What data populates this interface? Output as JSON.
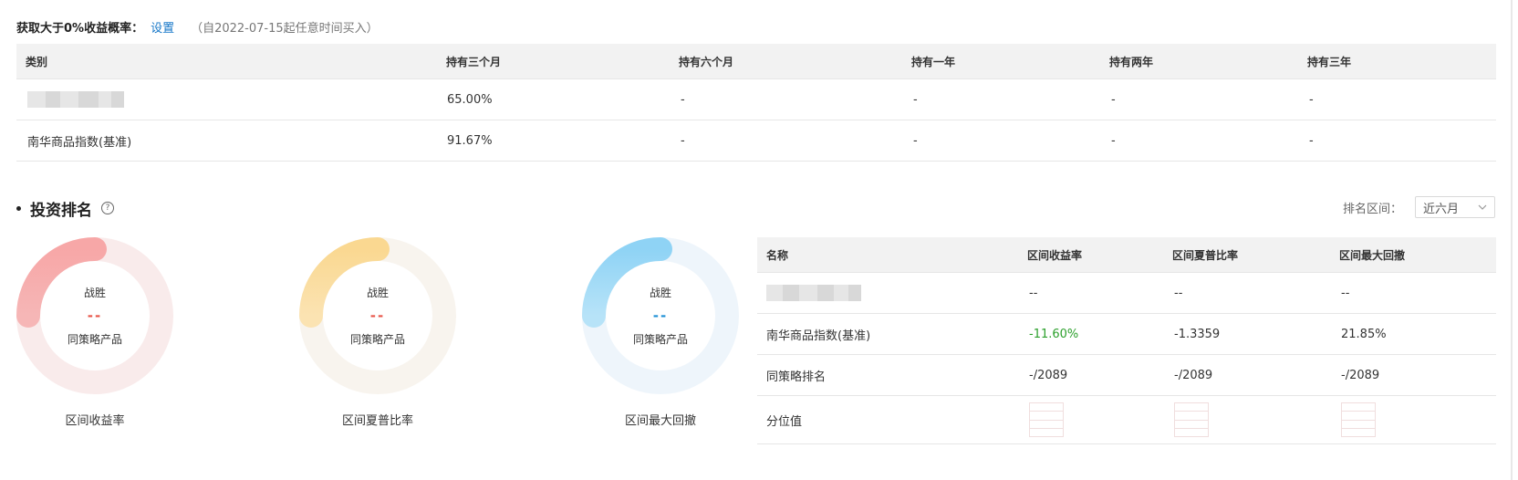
{
  "probability": {
    "label": "获取大于0%收益概率：",
    "link": "设置",
    "note": "（自2022-07-15起任意时间买入）"
  },
  "holding_table": {
    "headers": [
      "类别",
      "持有三个月",
      "持有六个月",
      "持有一年",
      "持有两年",
      "持有三年"
    ],
    "rows": [
      {
        "name": "",
        "values": [
          "65.00%",
          "-",
          "-",
          "-",
          "-"
        ]
      },
      {
        "name": "南华商品指数(基准)",
        "values": [
          "91.67%",
          "-",
          "-",
          "-",
          "-"
        ]
      }
    ]
  },
  "ranking": {
    "title": "投资排名",
    "range_label": "排名区间：",
    "range_value": "近六月"
  },
  "donuts": [
    {
      "win_label": "战胜",
      "value": "--",
      "peer_label": "同策略产品",
      "caption": "区间收益率",
      "value_color": "#e8564a",
      "ring_light": "#f9ebeb",
      "arc_start": "#f7a7a7",
      "arc_end": "#f6b6b6"
    },
    {
      "win_label": "战胜",
      "value": "--",
      "peer_label": "同策略产品",
      "caption": "区间夏普比率",
      "value_color": "#e8564a",
      "ring_light": "#f8f4ee",
      "arc_start": "#fad891",
      "arc_end": "#fbe3b2"
    },
    {
      "win_label": "战胜",
      "value": "--",
      "peer_label": "同策略产品",
      "caption": "区间最大回撤",
      "value_color": "#1e90d6",
      "ring_light": "#eef5fb",
      "arc_start": "#8fd3f5",
      "arc_end": "#b7e3f8"
    }
  ],
  "rank_table": {
    "headers": [
      "名称",
      "区间收益率",
      "区间夏普比率",
      "区间最大回撤"
    ],
    "rows": [
      {
        "name": "",
        "values": [
          "--",
          "--",
          "--"
        ]
      },
      {
        "name": "南华商品指数(基准)",
        "values": [
          "-11.60%",
          "-1.3359",
          "21.85%"
        ]
      },
      {
        "name": "同策略排名",
        "values": [
          "-/2089",
          "-/2089",
          "-/2089"
        ]
      },
      {
        "name": "分位值",
        "values": [
          "",
          "",
          ""
        ]
      }
    ]
  },
  "colors": {
    "link": "#1677c8",
    "negative": "#2ca02c",
    "header_bg": "#f2f2f2"
  }
}
